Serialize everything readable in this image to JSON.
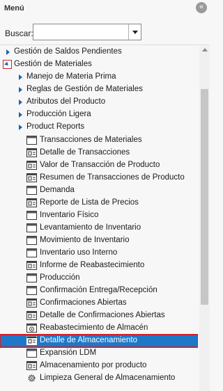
{
  "menu": {
    "title": "Menú",
    "collapse_icon": "double-chevron-left-icon"
  },
  "search": {
    "label": "Buscar:",
    "value": "",
    "placeholder": ""
  },
  "tree": {
    "top_items": [
      {
        "label": "Gestión de Saldos Pendientes",
        "state": "collapsed"
      },
      {
        "label": "Gestión de Materiales",
        "state": "expanded"
      }
    ],
    "folders": [
      {
        "label": "Manejo de Materia Prima"
      },
      {
        "label": "Reglas de Gestión de Materiales"
      },
      {
        "label": "Atributos del Producto"
      },
      {
        "label": "Producción Ligera"
      },
      {
        "label": "Product Reports"
      }
    ],
    "leaves": [
      {
        "label": "Transacciones de Materiales",
        "icon": "window-icon"
      },
      {
        "label": "Detalle de Transacciones",
        "icon": "report-icon"
      },
      {
        "label": "Valor de Transacción de Producto",
        "icon": "report-icon"
      },
      {
        "label": "Resumen de Transacciones de Producto",
        "icon": "report-icon"
      },
      {
        "label": "Demanda",
        "icon": "window-icon"
      },
      {
        "label": "Reporte de Lista de Precios",
        "icon": "report-icon"
      },
      {
        "label": "Inventario Físico",
        "icon": "window-icon"
      },
      {
        "label": "Levantamiento de Inventario",
        "icon": "window-icon"
      },
      {
        "label": "Movimiento de Inventario",
        "icon": "window-icon"
      },
      {
        "label": "Inventario uso Interno",
        "icon": "window-icon"
      },
      {
        "label": "Informe de Reabastecimiento",
        "icon": "report-icon"
      },
      {
        "label": "Producción",
        "icon": "window-icon"
      },
      {
        "label": "Confirmación Entrega/Recepción",
        "icon": "window-icon"
      },
      {
        "label": "Confirmaciones Abiertas",
        "icon": "report-icon"
      },
      {
        "label": "Detalle de Confirmaciones Abiertas",
        "icon": "report-icon"
      },
      {
        "label": "Reabastecimiento de Almacén",
        "icon": "process-icon"
      },
      {
        "label": "Detalle de Almacenamiento",
        "icon": "report-icon",
        "selected": true
      },
      {
        "label": "Expansión LDM",
        "icon": "window-icon"
      },
      {
        "label": "Almacenamiento por producto",
        "icon": "report-icon"
      },
      {
        "label": "Limpieza General de Almacenamiento",
        "icon": "gear-icon"
      }
    ]
  },
  "colors": {
    "selected_bg": "#1e78c8",
    "highlight_border": "#d21f2a",
    "expander": "#1b62b0"
  }
}
